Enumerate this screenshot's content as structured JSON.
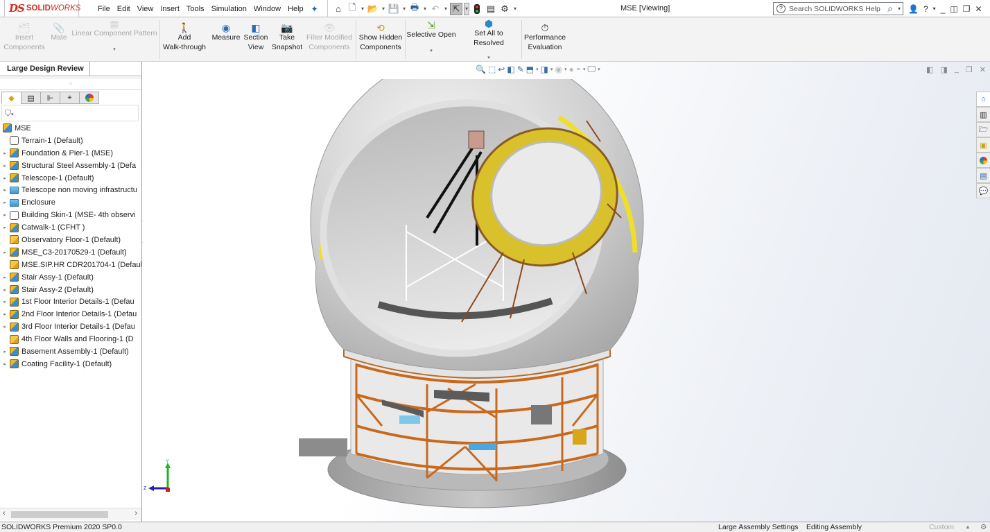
{
  "app": {
    "brand_ds": "DS",
    "brand_solid": "SOLID",
    "brand_works": "WORKS",
    "document_title": "MSE [Viewing]"
  },
  "menu": [
    "File",
    "Edit",
    "View",
    "Insert",
    "Tools",
    "Simulation",
    "Window",
    "Help"
  ],
  "quick_access": [
    {
      "name": "home",
      "glyph": "⌂"
    },
    {
      "name": "new-document",
      "glyph": "🗋"
    },
    {
      "name": "open",
      "glyph": "📂"
    },
    {
      "name": "save",
      "glyph": "💾"
    },
    {
      "name": "print",
      "glyph": "🖶"
    },
    {
      "name": "undo",
      "glyph": "↶"
    },
    {
      "name": "select",
      "glyph": "⇱"
    },
    {
      "name": "rebuild",
      "glyph": "⬮"
    },
    {
      "name": "file-properties",
      "glyph": "▤"
    },
    {
      "name": "options",
      "glyph": "⚙"
    }
  ],
  "help_search": {
    "placeholder": "Search SOLIDWORKS Help"
  },
  "ribbon": {
    "insert_components": [
      "Insert",
      "Components"
    ],
    "mate": "Mate",
    "linear_pattern": "Linear Component Pattern",
    "add_walkthrough": [
      "Add",
      "Walk-through"
    ],
    "measure": "Measure",
    "section_view": [
      "Section",
      "View"
    ],
    "take_snapshot": [
      "Take",
      "Snapshot"
    ],
    "filter_modified": [
      "Filter Modified",
      "Components"
    ],
    "show_hidden": [
      "Show Hidden",
      "Components"
    ],
    "selective_open": "Selective Open",
    "set_all_resolved": "Set All to Resolved",
    "performance_eval": [
      "Performance",
      "Evaluation"
    ]
  },
  "left_panel": {
    "tab_label": "Large Design Review",
    "filter_glyph": "⛉",
    "tree": [
      {
        "label": "MSE",
        "icon": "asm",
        "expander": false,
        "indent": 0
      },
      {
        "label": "Terrain-1 (Default)",
        "icon": "part",
        "expander": false,
        "indent": 1
      },
      {
        "label": "Foundation & Pier-1 (MSE)",
        "icon": "asm",
        "expander": true,
        "indent": 1
      },
      {
        "label": "Structural Steel Assembly-1 (Defa",
        "icon": "asm",
        "expander": true,
        "indent": 1
      },
      {
        "label": "Telescope-1 (Default)",
        "icon": "asm",
        "expander": true,
        "indent": 1
      },
      {
        "label": "Telescope non moving infrastructu",
        "icon": "folder",
        "expander": true,
        "indent": 1
      },
      {
        "label": "Enclosure",
        "icon": "folder",
        "expander": true,
        "indent": 1
      },
      {
        "label": "Building Skin-1 (MSE- 4th observi",
        "icon": "part",
        "expander": true,
        "indent": 1
      },
      {
        "label": "Catwalk-1 (CFHT )",
        "icon": "asm",
        "expander": true,
        "indent": 1
      },
      {
        "label": "Observatory Floor-1 (Default)",
        "icon": "asm-y",
        "expander": false,
        "indent": 1
      },
      {
        "label": "MSE_C3-20170529-1 (Default)",
        "icon": "asm",
        "expander": true,
        "indent": 1
      },
      {
        "label": "MSE.SIP.HR CDR201704-1 (Defaul",
        "icon": "asm-y",
        "expander": false,
        "indent": 1
      },
      {
        "label": "Stair Assy-1 (Default)",
        "icon": "asm",
        "expander": true,
        "indent": 1
      },
      {
        "label": "Stair Assy-2 (Default)",
        "icon": "asm",
        "expander": true,
        "indent": 1
      },
      {
        "label": "1st Floor Interior Details-1 (Defau",
        "icon": "asm",
        "expander": true,
        "indent": 1
      },
      {
        "label": "2nd Floor Interior Details-1 (Defau",
        "icon": "asm",
        "expander": true,
        "indent": 1
      },
      {
        "label": "3rd Floor Interior Details-1 (Defau",
        "icon": "asm",
        "expander": true,
        "indent": 1
      },
      {
        "label": "4th Floor Walls and Flooring-1 (D",
        "icon": "asm-y",
        "expander": false,
        "indent": 1
      },
      {
        "label": "Basement Assembly-1 (Default)",
        "icon": "asm",
        "expander": true,
        "indent": 1
      },
      {
        "label": "Coating Facility-1 (Default)",
        "icon": "asm",
        "expander": true,
        "indent": 1
      }
    ]
  },
  "triad": {
    "y": "Y",
    "z": "Z"
  },
  "statusbar": {
    "product": "SOLIDWORKS Premium 2020 SP0.0",
    "large_assembly": "Large Assembly Settings",
    "mode": "Editing Assembly",
    "units": "Custom"
  }
}
